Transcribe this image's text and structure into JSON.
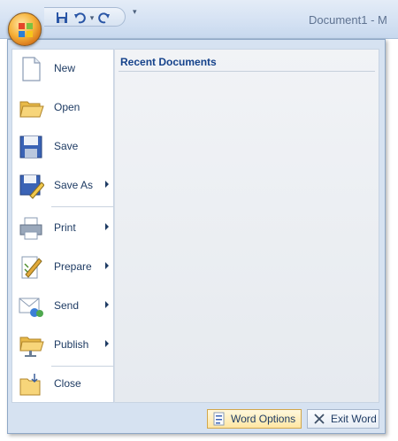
{
  "window": {
    "title": "Document1 - M"
  },
  "quick_access": {
    "items": [
      "save-icon",
      "undo-icon",
      "undo-dropdown",
      "redo-icon",
      "customize-dropdown"
    ],
    "undo_dropdown_glyph": "▾",
    "customize_glyph": "▾"
  },
  "office_menu": {
    "recent_header": "Recent Documents",
    "items": [
      {
        "label": "New",
        "icon": "new-document-icon",
        "has_submenu": false
      },
      {
        "label": "Open",
        "icon": "open-folder-icon",
        "has_submenu": false
      },
      {
        "label": "Save",
        "icon": "save-disk-icon",
        "has_submenu": false
      },
      {
        "label": "Save As",
        "icon": "save-as-icon",
        "has_submenu": true
      },
      {
        "label": "Print",
        "icon": "printer-icon",
        "has_submenu": true
      },
      {
        "label": "Prepare",
        "icon": "prepare-icon",
        "has_submenu": true
      },
      {
        "label": "Send",
        "icon": "send-icon",
        "has_submenu": true
      },
      {
        "label": "Publish",
        "icon": "publish-icon",
        "has_submenu": true
      },
      {
        "label": "Close",
        "icon": "close-folder-icon",
        "has_submenu": false
      }
    ],
    "word_options_label": "Word Options",
    "exit_label": "Exit Word"
  },
  "colors": {
    "menu_text": "#1e3b63",
    "header_text": "#15428b",
    "ribbon_blue": "#d6e2f1",
    "office_orange": "#f6b23a"
  }
}
